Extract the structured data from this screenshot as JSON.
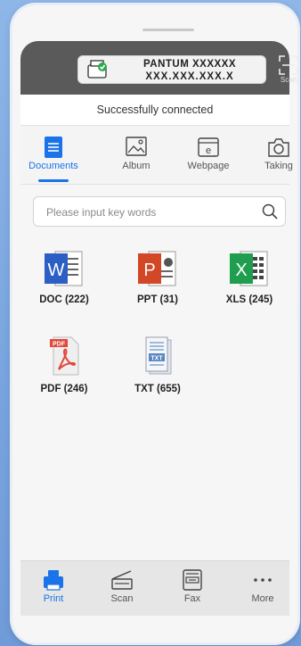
{
  "printer": {
    "name": "PANTUM XXXXXX",
    "ip": "XXX.XXX.XXX.X",
    "scan_label": "Scan"
  },
  "status": {
    "text": "Successfully connected"
  },
  "tabs": [
    {
      "label": "Documents",
      "icon": "document-icon",
      "active": true
    },
    {
      "label": "Album",
      "icon": "image-icon",
      "active": false
    },
    {
      "label": "Webpage",
      "icon": "webpage-icon",
      "active": false
    },
    {
      "label": "Taking",
      "icon": "camera-icon",
      "active": false
    }
  ],
  "search": {
    "placeholder": "Please input key words",
    "value": ""
  },
  "files": [
    {
      "label": "DOC (222)",
      "icon": "word-doc-icon"
    },
    {
      "label": "PPT (31)",
      "icon": "powerpoint-icon"
    },
    {
      "label": "XLS (245)",
      "icon": "excel-icon"
    },
    {
      "label": "PDF (246)",
      "icon": "pdf-icon"
    },
    {
      "label": "TXT (655)",
      "icon": "txt-file-icon"
    }
  ],
  "bottom_nav": [
    {
      "label": "Print",
      "icon": "printer-icon",
      "active": true
    },
    {
      "label": "Scan",
      "icon": "scanner-icon",
      "active": false
    },
    {
      "label": "Fax",
      "icon": "fax-icon",
      "active": false
    },
    {
      "label": "More",
      "icon": "more-dots-icon",
      "active": false
    }
  ],
  "colors": {
    "accent": "#1a73e8",
    "topbar": "#5a5a5a",
    "background": "#7aa6df",
    "word": "#2b5fc4",
    "powerpoint": "#d24726",
    "excel": "#1f9e4f",
    "pdf": "#e0483a",
    "connected_check": "#2aa84a"
  }
}
